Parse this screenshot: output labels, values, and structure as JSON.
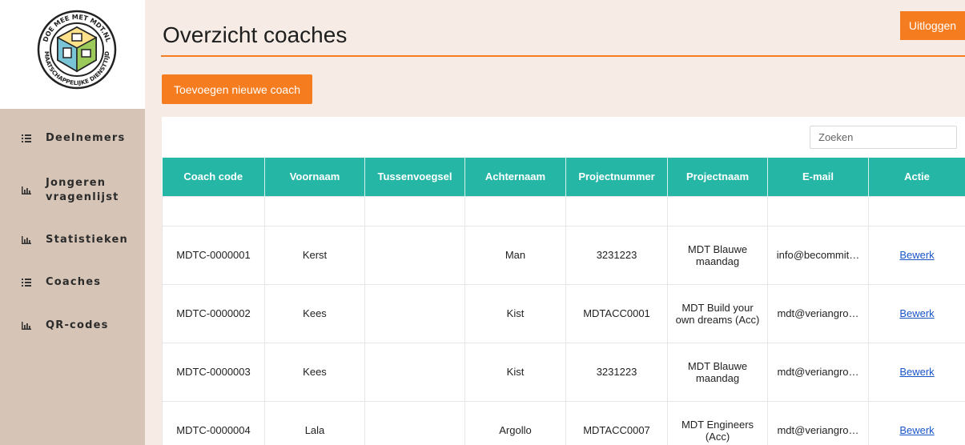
{
  "logo": {
    "ring_text_top": "DOE MEE MET MDT.NL",
    "ring_text_bottom": "MAATSCHAPPELIJKE DIENSTTIJD"
  },
  "sidebar": {
    "items": [
      {
        "label": "Deelnemers",
        "icon": "list-icon"
      },
      {
        "label": "Jongeren vragenlijst",
        "icon": "bar-chart-icon"
      },
      {
        "label": "Statistieken",
        "icon": "bar-chart-icon"
      },
      {
        "label": "Coaches",
        "icon": "list-icon"
      },
      {
        "label": "QR-codes",
        "icon": "bar-chart-icon"
      }
    ]
  },
  "header": {
    "title": "Overzicht coaches",
    "logout_label": "Uitloggen",
    "add_label": "Toevoegen nieuwe coach"
  },
  "search": {
    "placeholder": "Zoeken",
    "value": ""
  },
  "table": {
    "columns": [
      "Coach code",
      "Voornaam",
      "Tussenvoegsel",
      "Achternaam",
      "Projectnummer",
      "Projectnaam",
      "E-mail",
      "Actie"
    ],
    "rows": [
      {
        "code": "MDTC-0000001",
        "first": "Kerst",
        "infix": "",
        "last": "Man",
        "project_no": "3231223",
        "project_name": "MDT Blauwe maandag",
        "email": "info@becommit…",
        "action": "Bewerk"
      },
      {
        "code": "MDTC-0000002",
        "first": "Kees",
        "infix": "",
        "last": "Kist",
        "project_no": "MDTACC0001",
        "project_name": "MDT Build your own dreams (Acc)",
        "email": "mdt@veriangro…",
        "action": "Bewerk"
      },
      {
        "code": "MDTC-0000003",
        "first": "Kees",
        "infix": "",
        "last": "Kist",
        "project_no": "3231223",
        "project_name": "MDT Blauwe maandag",
        "email": "mdt@veriangro…",
        "action": "Bewerk"
      },
      {
        "code": "MDTC-0000004",
        "first": "Lala",
        "infix": "",
        "last": "Argollo",
        "project_no": "MDTACC0007",
        "project_name": "MDT Engineers (Acc)",
        "email": "mdt@veriangro…",
        "action": "Bewerk"
      }
    ]
  },
  "colors": {
    "accent": "#f57c1f",
    "table_header": "#26b6a6",
    "sidebar": "#d6c5b6",
    "main_bg": "#f6ece5",
    "link": "#1a55c8"
  }
}
